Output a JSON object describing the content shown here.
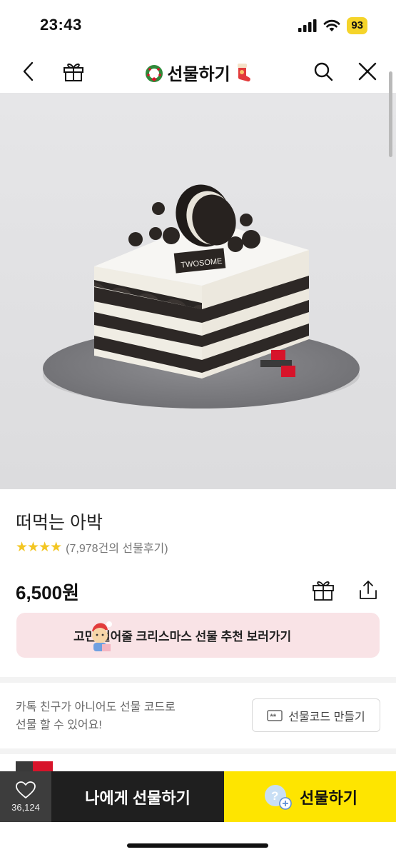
{
  "status": {
    "time": "23:43",
    "battery": "93"
  },
  "nav": {
    "title": "선물하기"
  },
  "hero": {
    "plate_logo": "TWOSOME"
  },
  "product": {
    "name": "떠먹는 아박",
    "stars": "★★★★",
    "review_text": "(7,978건의 선물후기)",
    "price": "6,500원"
  },
  "banner": {
    "text": "고민 덜어줄 크리스마스 선물 추천 보러가기"
  },
  "gift_code": {
    "desc_line1": "카톡 친구가 아니어도 선물 코드로",
    "desc_line2": "선물 할 수 있어요!",
    "button_label": "선물코드 만들기",
    "button_icon_text": "**"
  },
  "bottom": {
    "like_count": "36,124",
    "self_gift_label": "나에게 선물하기",
    "gift_label": "선물하기",
    "gift_icon_text": "?"
  },
  "colors": {
    "accent_yellow": "#fee500",
    "banner_pink": "#f9e3e6",
    "star": "#f3c623",
    "brand_red": "#d7142a"
  },
  "icons": [
    "signal-icon",
    "wifi-icon",
    "back-icon",
    "gift-icon",
    "wreath-icon",
    "stocking-icon",
    "search-icon",
    "close-icon",
    "share-icon",
    "heart-icon",
    "coupon-icon"
  ]
}
